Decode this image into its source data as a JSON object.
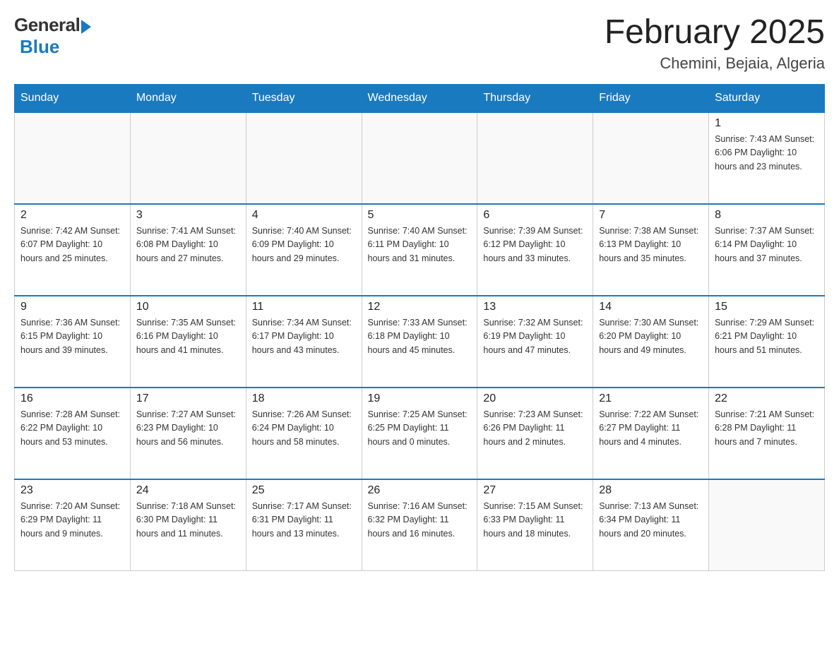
{
  "logo": {
    "general": "General",
    "blue": "Blue"
  },
  "title": {
    "month_year": "February 2025",
    "location": "Chemini, Bejaia, Algeria"
  },
  "weekdays": [
    "Sunday",
    "Monday",
    "Tuesday",
    "Wednesday",
    "Thursday",
    "Friday",
    "Saturday"
  ],
  "weeks": [
    [
      {
        "day": "",
        "detail": ""
      },
      {
        "day": "",
        "detail": ""
      },
      {
        "day": "",
        "detail": ""
      },
      {
        "day": "",
        "detail": ""
      },
      {
        "day": "",
        "detail": ""
      },
      {
        "day": "",
        "detail": ""
      },
      {
        "day": "1",
        "detail": "Sunrise: 7:43 AM\nSunset: 6:06 PM\nDaylight: 10 hours\nand 23 minutes."
      }
    ],
    [
      {
        "day": "2",
        "detail": "Sunrise: 7:42 AM\nSunset: 6:07 PM\nDaylight: 10 hours\nand 25 minutes."
      },
      {
        "day": "3",
        "detail": "Sunrise: 7:41 AM\nSunset: 6:08 PM\nDaylight: 10 hours\nand 27 minutes."
      },
      {
        "day": "4",
        "detail": "Sunrise: 7:40 AM\nSunset: 6:09 PM\nDaylight: 10 hours\nand 29 minutes."
      },
      {
        "day": "5",
        "detail": "Sunrise: 7:40 AM\nSunset: 6:11 PM\nDaylight: 10 hours\nand 31 minutes."
      },
      {
        "day": "6",
        "detail": "Sunrise: 7:39 AM\nSunset: 6:12 PM\nDaylight: 10 hours\nand 33 minutes."
      },
      {
        "day": "7",
        "detail": "Sunrise: 7:38 AM\nSunset: 6:13 PM\nDaylight: 10 hours\nand 35 minutes."
      },
      {
        "day": "8",
        "detail": "Sunrise: 7:37 AM\nSunset: 6:14 PM\nDaylight: 10 hours\nand 37 minutes."
      }
    ],
    [
      {
        "day": "9",
        "detail": "Sunrise: 7:36 AM\nSunset: 6:15 PM\nDaylight: 10 hours\nand 39 minutes."
      },
      {
        "day": "10",
        "detail": "Sunrise: 7:35 AM\nSunset: 6:16 PM\nDaylight: 10 hours\nand 41 minutes."
      },
      {
        "day": "11",
        "detail": "Sunrise: 7:34 AM\nSunset: 6:17 PM\nDaylight: 10 hours\nand 43 minutes."
      },
      {
        "day": "12",
        "detail": "Sunrise: 7:33 AM\nSunset: 6:18 PM\nDaylight: 10 hours\nand 45 minutes."
      },
      {
        "day": "13",
        "detail": "Sunrise: 7:32 AM\nSunset: 6:19 PM\nDaylight: 10 hours\nand 47 minutes."
      },
      {
        "day": "14",
        "detail": "Sunrise: 7:30 AM\nSunset: 6:20 PM\nDaylight: 10 hours\nand 49 minutes."
      },
      {
        "day": "15",
        "detail": "Sunrise: 7:29 AM\nSunset: 6:21 PM\nDaylight: 10 hours\nand 51 minutes."
      }
    ],
    [
      {
        "day": "16",
        "detail": "Sunrise: 7:28 AM\nSunset: 6:22 PM\nDaylight: 10 hours\nand 53 minutes."
      },
      {
        "day": "17",
        "detail": "Sunrise: 7:27 AM\nSunset: 6:23 PM\nDaylight: 10 hours\nand 56 minutes."
      },
      {
        "day": "18",
        "detail": "Sunrise: 7:26 AM\nSunset: 6:24 PM\nDaylight: 10 hours\nand 58 minutes."
      },
      {
        "day": "19",
        "detail": "Sunrise: 7:25 AM\nSunset: 6:25 PM\nDaylight: 11 hours\nand 0 minutes."
      },
      {
        "day": "20",
        "detail": "Sunrise: 7:23 AM\nSunset: 6:26 PM\nDaylight: 11 hours\nand 2 minutes."
      },
      {
        "day": "21",
        "detail": "Sunrise: 7:22 AM\nSunset: 6:27 PM\nDaylight: 11 hours\nand 4 minutes."
      },
      {
        "day": "22",
        "detail": "Sunrise: 7:21 AM\nSunset: 6:28 PM\nDaylight: 11 hours\nand 7 minutes."
      }
    ],
    [
      {
        "day": "23",
        "detail": "Sunrise: 7:20 AM\nSunset: 6:29 PM\nDaylight: 11 hours\nand 9 minutes."
      },
      {
        "day": "24",
        "detail": "Sunrise: 7:18 AM\nSunset: 6:30 PM\nDaylight: 11 hours\nand 11 minutes."
      },
      {
        "day": "25",
        "detail": "Sunrise: 7:17 AM\nSunset: 6:31 PM\nDaylight: 11 hours\nand 13 minutes."
      },
      {
        "day": "26",
        "detail": "Sunrise: 7:16 AM\nSunset: 6:32 PM\nDaylight: 11 hours\nand 16 minutes."
      },
      {
        "day": "27",
        "detail": "Sunrise: 7:15 AM\nSunset: 6:33 PM\nDaylight: 11 hours\nand 18 minutes."
      },
      {
        "day": "28",
        "detail": "Sunrise: 7:13 AM\nSunset: 6:34 PM\nDaylight: 11 hours\nand 20 minutes."
      },
      {
        "day": "",
        "detail": ""
      }
    ]
  ]
}
